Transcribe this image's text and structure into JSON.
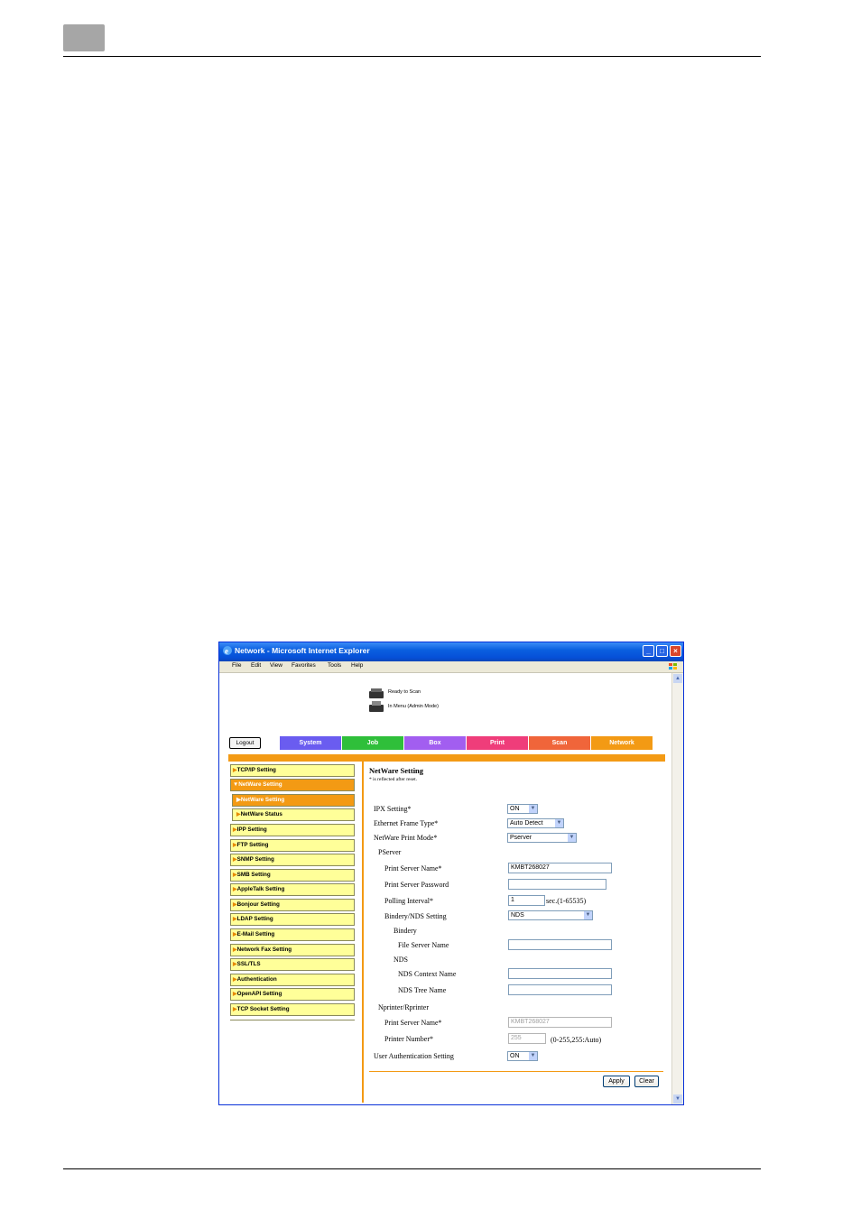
{
  "browser": {
    "title": "Network - Microsoft Internet Explorer",
    "menu": [
      "File",
      "Edit",
      "View",
      "Favorites",
      "Tools",
      "Help"
    ]
  },
  "status": {
    "line1": "Ready to Scan",
    "line2": "In Menu (Admin Mode)"
  },
  "header": {
    "logout_label": "Logout",
    "tabs": [
      {
        "label": "System",
        "color": "#6a5cf0"
      },
      {
        "label": "Job",
        "color": "#2fbf3a"
      },
      {
        "label": "Box",
        "color": "#a25ef0"
      },
      {
        "label": "Print",
        "color": "#ef3d7a"
      },
      {
        "label": "Scan",
        "color": "#f0653a"
      },
      {
        "label": "Network",
        "color": "#f39a14"
      }
    ]
  },
  "sidebar": {
    "items": [
      "TCP/IP Setting",
      "NetWare Setting",
      "NetWare Setting",
      "NetWare Status",
      "IPP Setting",
      "FTP Setting",
      "SNMP Setting",
      "SMB Setting",
      "AppleTalk Setting",
      "Bonjour Setting",
      "LDAP Setting",
      "E-Mail Setting",
      "Network Fax Setting",
      "SSL/TLS",
      "Authentication",
      "OpenAPI Setting",
      "TCP Socket Setting"
    ]
  },
  "content": {
    "title": "NetWare Setting",
    "note": "* is reflected after reset.",
    "ipx_label": "IPX Setting*",
    "ipx_value": "ON",
    "frame_label": "Ethernet Frame Type*",
    "frame_value": "Auto Detect",
    "print_mode_label": "NetWare Print Mode*",
    "print_mode_value": "Pserver",
    "pserver_heading": "PServer",
    "ps_name_label": "Print Server Name*",
    "ps_name_value": "KMBT268027",
    "ps_password_label": "Print Server Password",
    "polling_label": "Polling Interval*",
    "polling_value": "1",
    "polling_unit": "sec.(1-65535)",
    "bindery_nds_label": "Bindery/NDS Setting",
    "bindery_nds_value": "NDS",
    "bindery_heading": "Bindery",
    "file_server_label": "File Server Name",
    "nds_heading": "NDS",
    "nds_context_label": "NDS Context Name",
    "nds_tree_label": "NDS Tree Name",
    "nprinter_heading": "Nprinter/Rprinter",
    "np_server_label": "Print Server Name*",
    "np_server_value": "KMBT268027",
    "printer_number_label": "Printer Number*",
    "printer_number_value": "255",
    "printer_number_range": "(0-255,255:Auto)",
    "user_auth_label": "User Authentication Setting",
    "user_auth_value": "ON",
    "apply_label": "Apply",
    "clear_label": "Clear"
  }
}
